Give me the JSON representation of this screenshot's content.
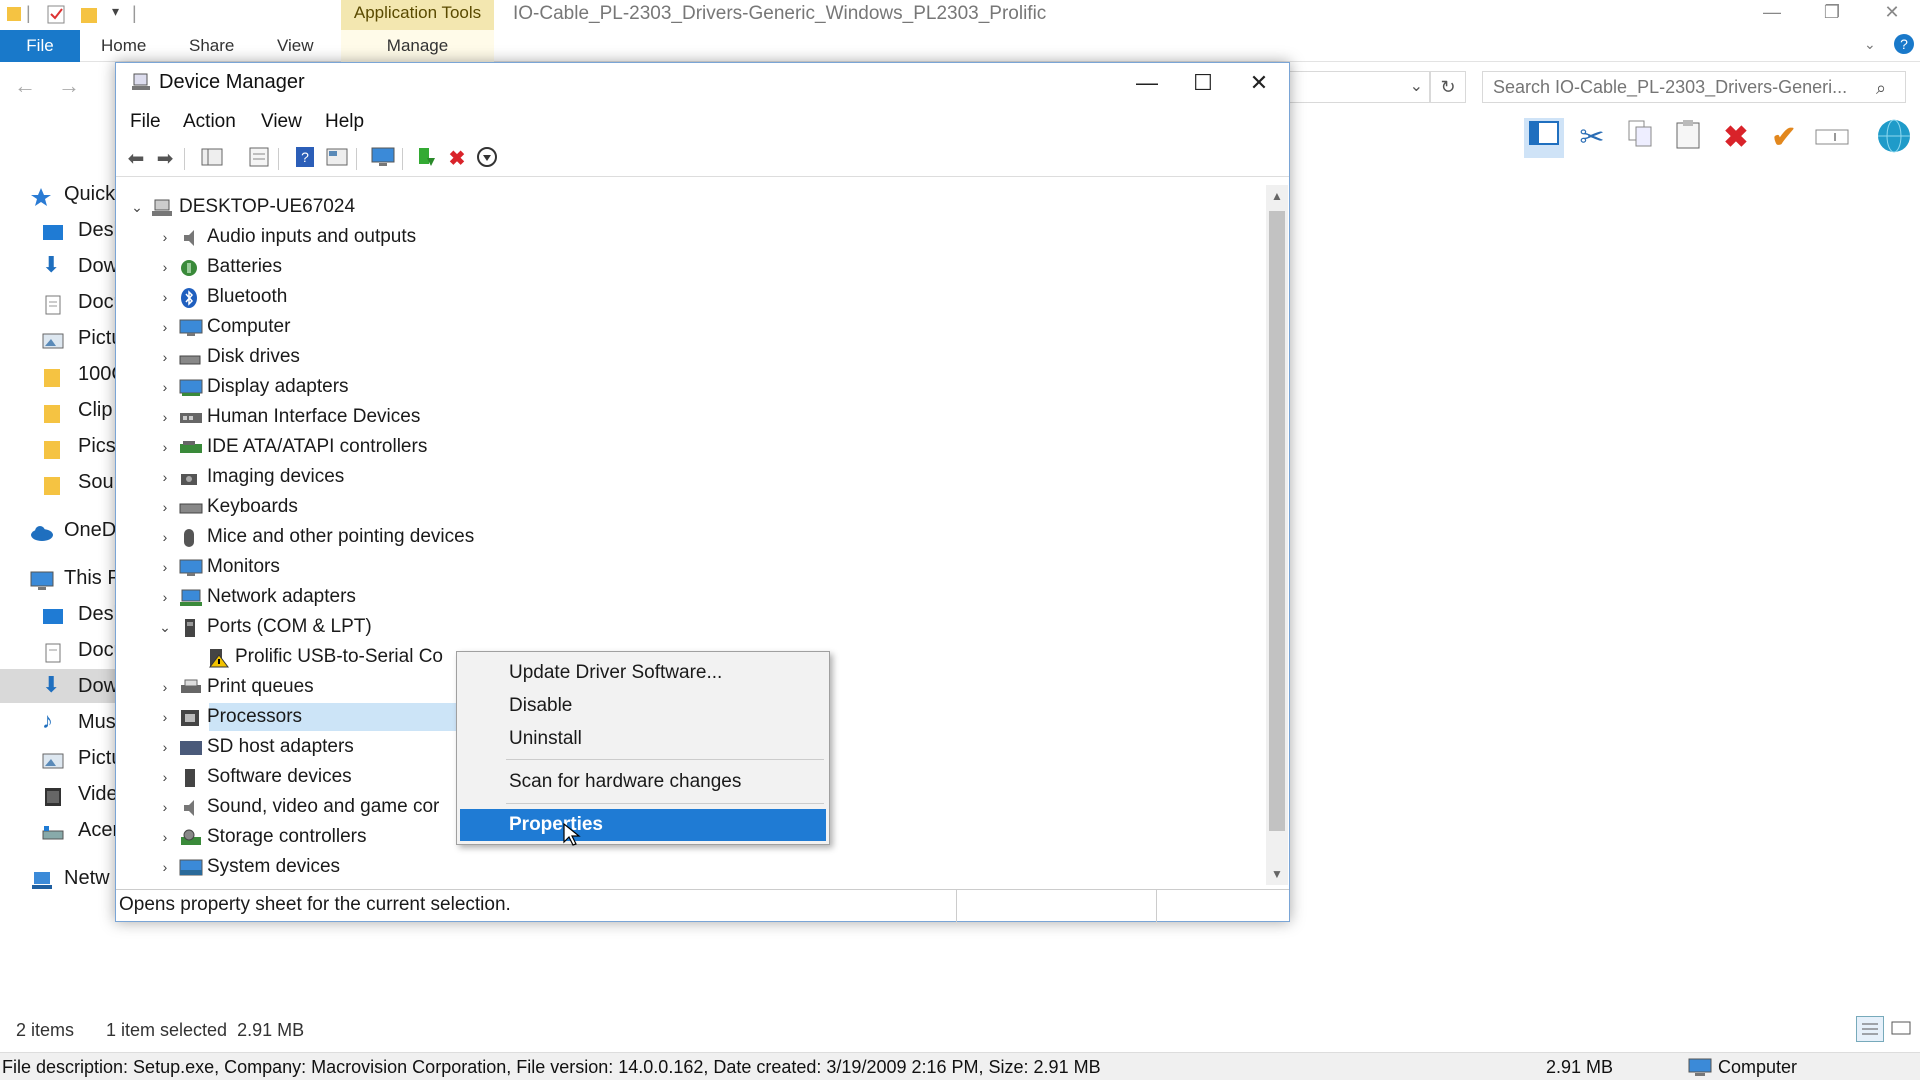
{
  "explorer": {
    "title": "IO-Cable_PL-2303_Drivers-Generic_Windows_PL2303_Prolific",
    "app_tools_label": "Application Tools",
    "tabs": {
      "file": "File",
      "home": "Home",
      "share": "Share",
      "view": "View",
      "manage": "Manage"
    },
    "search_placeholder": "Search IO-Cable_PL-2303_Drivers-Generi...",
    "nav_items": [
      {
        "label": "Quick",
        "icon": "star-icon"
      },
      {
        "label": "Desk",
        "icon": "desktop-icon"
      },
      {
        "label": "Dow",
        "icon": "download-icon"
      },
      {
        "label": "Docu",
        "icon": "document-icon"
      },
      {
        "label": "Pictu",
        "icon": "pictures-icon"
      },
      {
        "label": "100C",
        "icon": "folder-icon"
      },
      {
        "label": "Clip",
        "icon": "folder-icon"
      },
      {
        "label": "Pics",
        "icon": "folder-icon"
      },
      {
        "label": "Sour",
        "icon": "folder-icon"
      },
      {
        "label": "OneD",
        "icon": "cloud-icon"
      },
      {
        "label": "This P",
        "icon": "computer-icon"
      },
      {
        "label": "Desk",
        "icon": "desktop-icon"
      },
      {
        "label": "Docu",
        "icon": "document-icon"
      },
      {
        "label": "Dow",
        "icon": "download-icon"
      },
      {
        "label": "Mus",
        "icon": "music-icon"
      },
      {
        "label": "Pictu",
        "icon": "pictures-icon"
      },
      {
        "label": "Vide",
        "icon": "video-icon"
      },
      {
        "label": "Acer",
        "icon": "drive-icon"
      },
      {
        "label": "Netw",
        "icon": "network-icon"
      }
    ],
    "status": {
      "items": "2 items",
      "selected": "1 item selected  2.91 MB"
    },
    "file_description": "File description: Setup.exe, Company: Macrovision Corporation, File version: 14.0.0.162, Date created: 3/19/2009 2:16 PM, Size: 2.91 MB",
    "size_right": "2.91 MB",
    "location": "Computer"
  },
  "device_manager": {
    "title": "Device Manager",
    "menu": {
      "file": "File",
      "action": "Action",
      "view": "View",
      "help": "Help"
    },
    "root": "DESKTOP-UE67024",
    "categories": [
      "Audio inputs and outputs",
      "Batteries",
      "Bluetooth",
      "Computer",
      "Disk drives",
      "Display adapters",
      "Human Interface Devices",
      "IDE ATA/ATAPI controllers",
      "Imaging devices",
      "Keyboards",
      "Mice and other pointing devices",
      "Monitors",
      "Network adapters",
      "Ports (COM & LPT)",
      "Print queues",
      "Processors",
      "SD host adapters",
      "Software devices",
      "Sound, video and game cor",
      "Storage controllers",
      "System devices"
    ],
    "selected_device": "Prolific USB-to-Serial Co",
    "status_text": "Opens property sheet for the current selection."
  },
  "context_menu": {
    "update": "Update Driver Software...",
    "disable": "Disable",
    "uninstall": "Uninstall",
    "scan": "Scan for hardware changes",
    "properties": "Properties"
  }
}
